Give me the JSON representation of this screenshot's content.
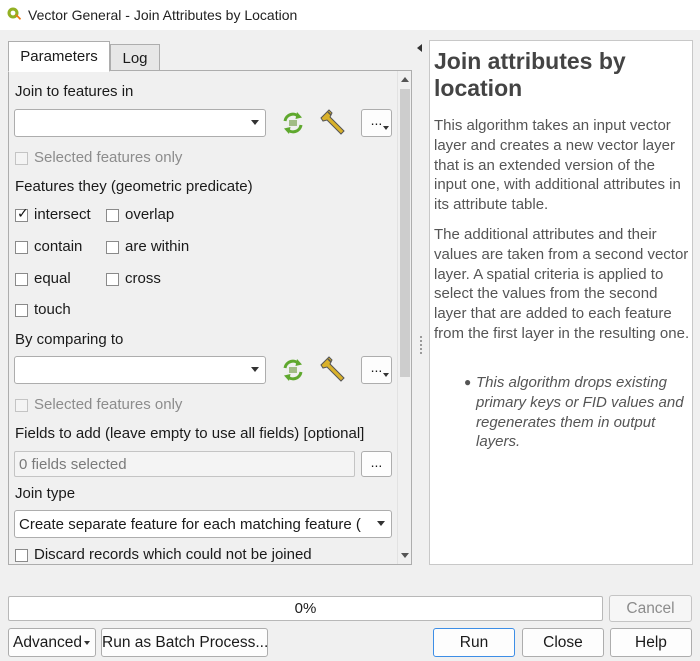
{
  "window": {
    "title": "Vector General - Join Attributes by Location"
  },
  "tabs": [
    {
      "label": "Parameters"
    },
    {
      "label": "Log"
    }
  ],
  "params": {
    "join_to_label": "Join to features in",
    "join_to_value": "",
    "selected_only_1": "Selected features only",
    "predicate_label": "Features they (geometric predicate)",
    "predicates": {
      "intersect": {
        "label": "intersect",
        "checked": true
      },
      "overlap": {
        "label": "overlap",
        "checked": false
      },
      "contain": {
        "label": "contain",
        "checked": false
      },
      "are_within": {
        "label": "are within",
        "checked": false
      },
      "equal": {
        "label": "equal",
        "checked": false
      },
      "cross": {
        "label": "cross",
        "checked": false
      },
      "touch": {
        "label": "touch",
        "checked": false
      }
    },
    "comparing_label": "By comparing to",
    "comparing_value": "",
    "selected_only_2": "Selected features only",
    "fields_label": "Fields to add (leave empty to use all fields) [optional]",
    "fields_value": "0 fields selected",
    "join_type_label": "Join type",
    "join_type_value": "Create separate feature for each matching feature (",
    "discard_label": "Discard records which could not be joined",
    "ellipsis": "..."
  },
  "help": {
    "title": "Join attributes by location",
    "p1": "This algorithm takes an input vector layer and creates a new vector layer that is an extended version of the input one, with additional attributes in its attribute table.",
    "p2": "The additional attributes and their values are taken from a second vector layer. A spatial criteria is applied to select the values from the second layer that are added to each feature from the first layer in the resulting one.",
    "note": "This algorithm drops existing primary keys or FID values and regenerates them in output layers."
  },
  "progress": {
    "text": "0%",
    "value": 0
  },
  "buttons": {
    "cancel": "Cancel",
    "advanced": "Advanced",
    "batch": "Run as Batch Process...",
    "run": "Run",
    "close": "Close",
    "help": "Help"
  },
  "colors": {
    "accent": "#3d8ee6",
    "refresh_icon": "#5fa82e",
    "wrench_icon": "#d9b12a"
  }
}
